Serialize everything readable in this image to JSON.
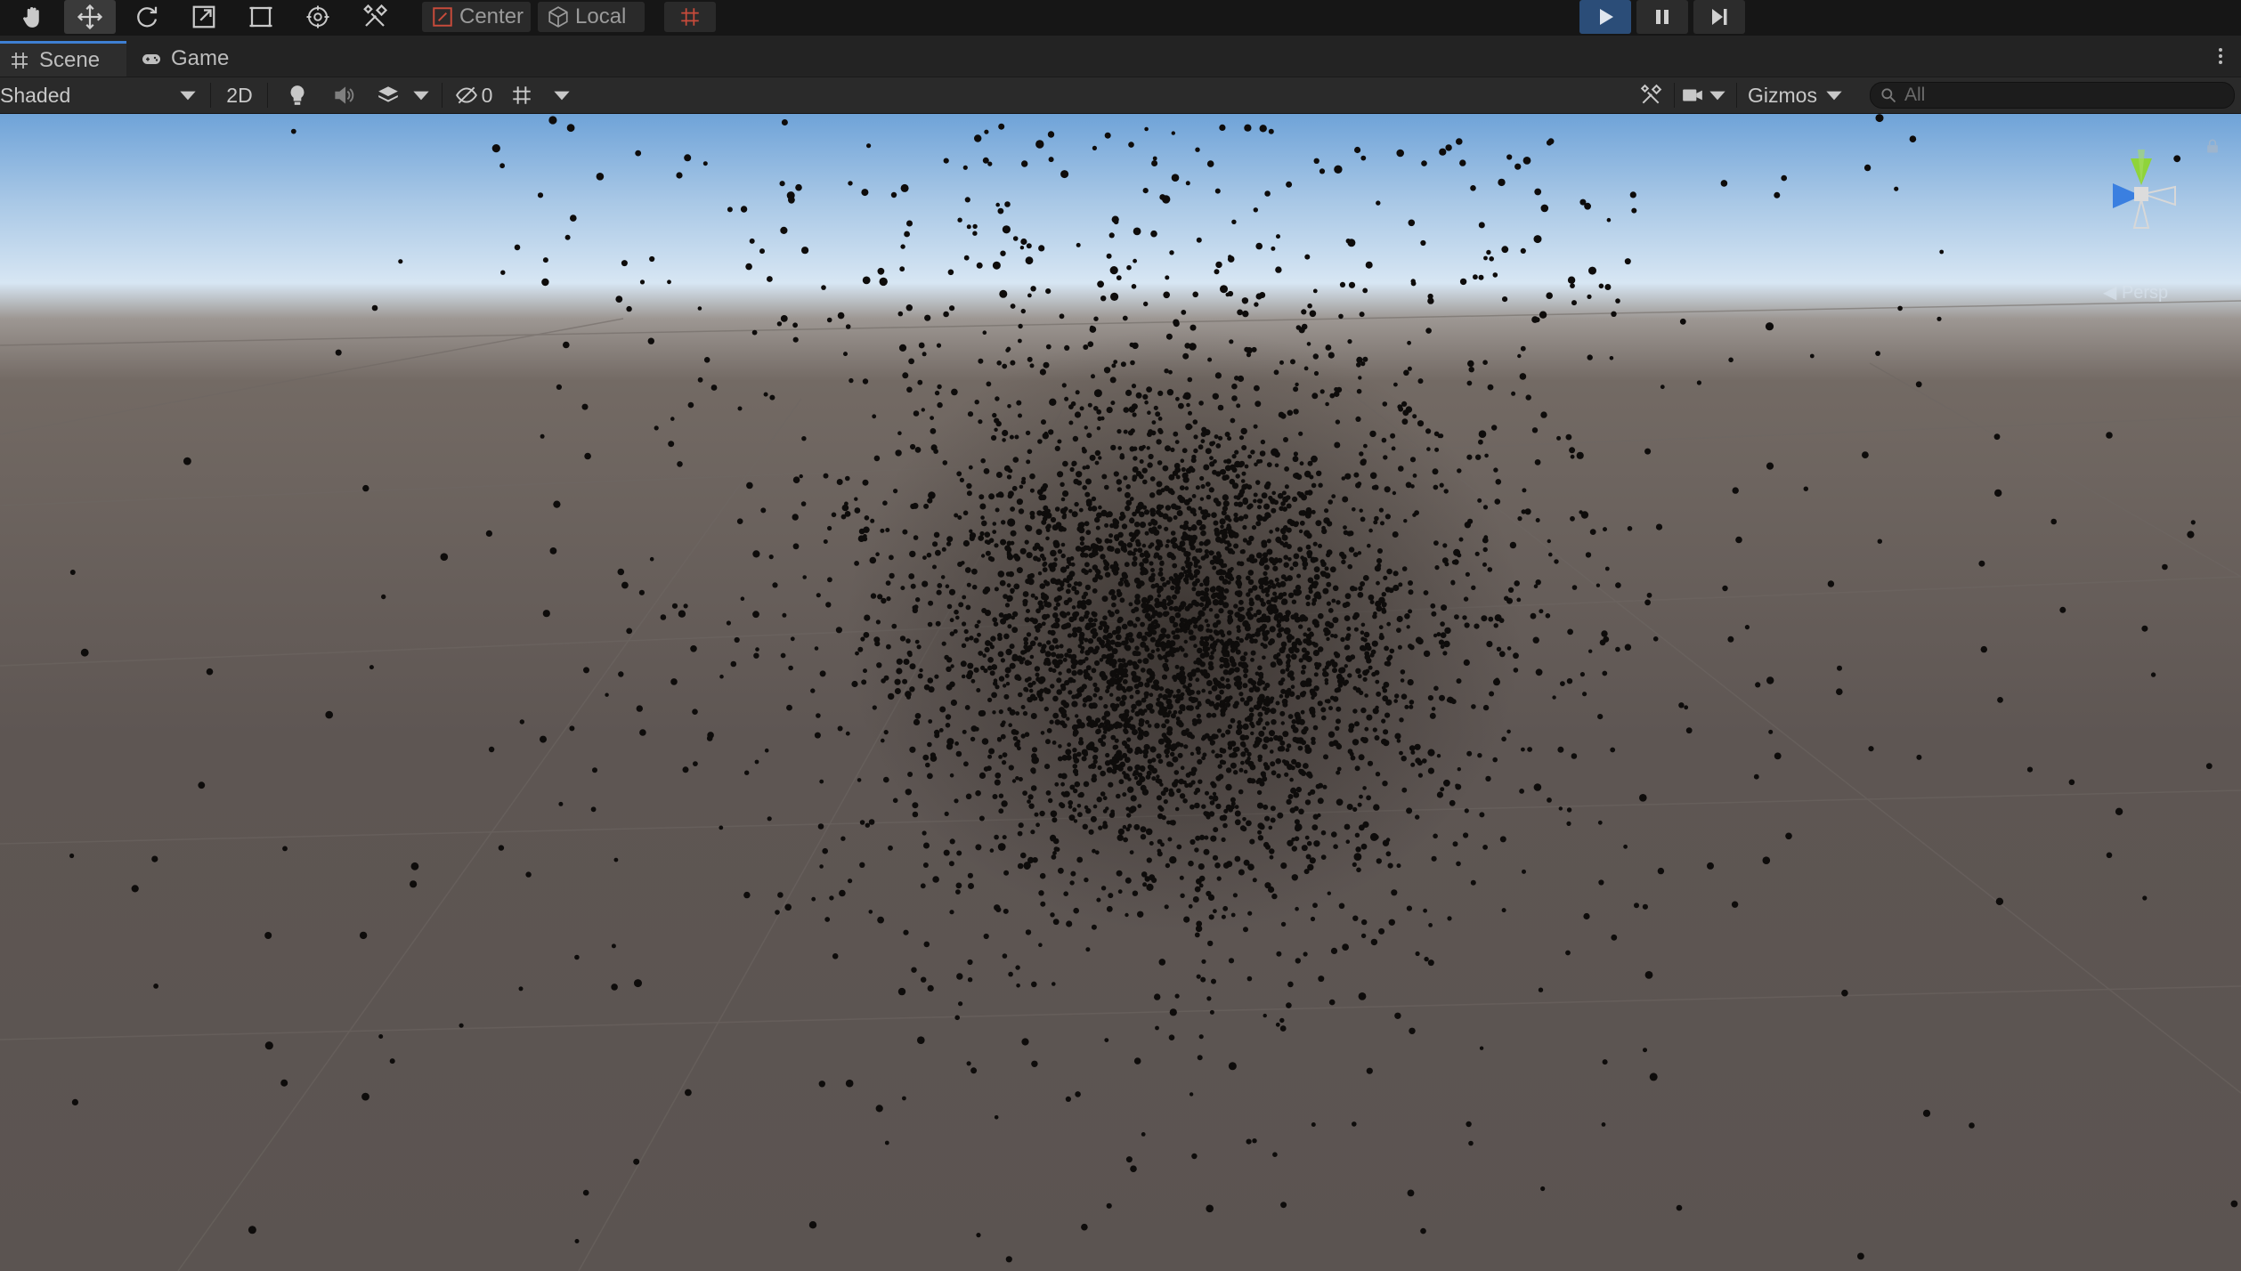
{
  "toolbar": {
    "tools": [
      {
        "name": "hand-tool",
        "icon": "hand-icon"
      },
      {
        "name": "move-tool",
        "icon": "move-icon",
        "active": true
      },
      {
        "name": "rotate-tool",
        "icon": "rotate-icon"
      },
      {
        "name": "scale-tool",
        "icon": "scale-icon"
      },
      {
        "name": "rect-tool",
        "icon": "rect-icon"
      },
      {
        "name": "transform-tool",
        "icon": "transform-icon"
      },
      {
        "name": "custom-tool",
        "icon": "custom-tool-icon"
      }
    ],
    "pivot_label": "Center",
    "space_label": "Local",
    "play_controls": [
      "play-icon",
      "pause-icon",
      "step-icon"
    ],
    "play_active": true
  },
  "tabs": [
    {
      "label": "Scene",
      "icon": "scene-grid-icon",
      "active": true
    },
    {
      "label": "Game",
      "icon": "gamepad-icon",
      "active": false
    }
  ],
  "scene_toolbar": {
    "draw_mode": "Shaded",
    "mode_2d": "2D",
    "hidden_count": "0",
    "gizmos_label": "Gizmos",
    "search_placeholder": "All"
  },
  "viewport": {
    "projection_label": "Persp",
    "colors": {
      "sky_top": "#6fa3d8",
      "horizon": "#d7e6f3",
      "ground": "#5e5653",
      "particle": "#0e0c0b",
      "gizmo_y": "#8fd43a",
      "gizmo_z": "#3a7fe0"
    }
  }
}
